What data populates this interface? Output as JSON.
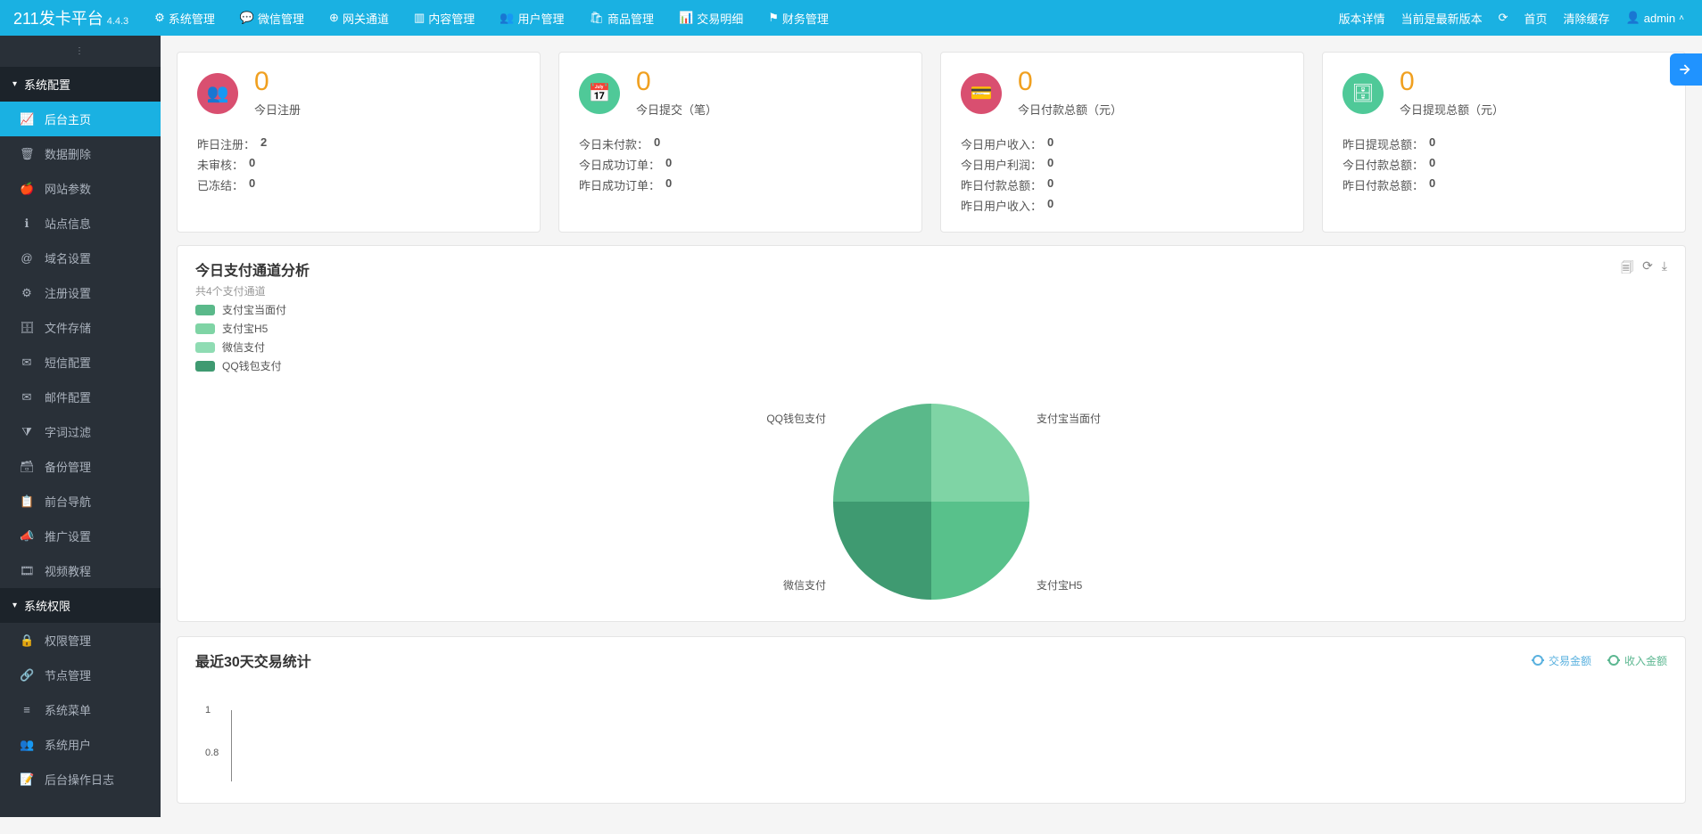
{
  "brand": {
    "name": "211发卡平台",
    "version": "4.4.3"
  },
  "top_nav": [
    {
      "label": "系统管理",
      "icon": "gear"
    },
    {
      "label": "微信管理",
      "icon": "wechat"
    },
    {
      "label": "网关通道",
      "icon": "globe"
    },
    {
      "label": "内容管理",
      "icon": "columns"
    },
    {
      "label": "用户管理",
      "icon": "users"
    },
    {
      "label": "商品管理",
      "icon": "shop"
    },
    {
      "label": "交易明细",
      "icon": "chart"
    },
    {
      "label": "财务管理",
      "icon": "flag"
    }
  ],
  "top_right": {
    "version_detail": "版本详情",
    "latest": "当前是最新版本",
    "refresh": "⟲",
    "home": "首页",
    "clear_cache": "清除缓存",
    "user": "admin"
  },
  "sidebar": {
    "groups": [
      {
        "title": "系统配置",
        "items": [
          {
            "label": "后台主页",
            "active": true
          },
          {
            "label": "数据删除"
          },
          {
            "label": "网站参数"
          },
          {
            "label": "站点信息"
          },
          {
            "label": "域名设置"
          },
          {
            "label": "注册设置"
          },
          {
            "label": "文件存储"
          },
          {
            "label": "短信配置"
          },
          {
            "label": "邮件配置"
          },
          {
            "label": "字词过滤"
          },
          {
            "label": "备份管理"
          },
          {
            "label": "前台导航"
          },
          {
            "label": "推广设置"
          },
          {
            "label": "视频教程"
          }
        ]
      },
      {
        "title": "系统权限",
        "items": [
          {
            "label": "权限管理"
          },
          {
            "label": "节点管理"
          },
          {
            "label": "系统菜单"
          },
          {
            "label": "系统用户"
          },
          {
            "label": "后台操作日志"
          }
        ]
      }
    ]
  },
  "stats": [
    {
      "color": "pink",
      "icon": "users",
      "value": "0",
      "label": "今日注册",
      "rows": [
        {
          "k": "昨日注册：",
          "v": "2"
        },
        {
          "k": "未审核：",
          "v": "0"
        },
        {
          "k": "已冻结：",
          "v": "0"
        }
      ]
    },
    {
      "color": "green",
      "icon": "calendar",
      "value": "0",
      "label": "今日提交（笔）",
      "rows": [
        {
          "k": "今日未付款：",
          "v": "0"
        },
        {
          "k": "今日成功订单：",
          "v": "0"
        },
        {
          "k": "昨日成功订单：",
          "v": "0"
        }
      ]
    },
    {
      "color": "pink",
      "icon": "card",
      "value": "0",
      "label": "今日付款总额（元）",
      "rows": [
        {
          "k": "今日用户收入：",
          "v": "0"
        },
        {
          "k": "今日用户利润：",
          "v": "0"
        },
        {
          "k": "昨日付款总额：",
          "v": "0"
        },
        {
          "k": "昨日用户收入：",
          "v": "0"
        }
      ]
    },
    {
      "color": "green",
      "icon": "db",
      "value": "0",
      "label": "今日提现总额（元）",
      "rows": [
        {
          "k": "昨日提现总额：",
          "v": "0"
        },
        {
          "k": "今日付款总额：",
          "v": "0"
        },
        {
          "k": "昨日付款总额：",
          "v": "0"
        }
      ]
    }
  ],
  "pie_panel": {
    "title": "今日支付通道分析",
    "subtitle": "共4个支付通道",
    "legend": [
      {
        "label": "支付宝当面付",
        "color": "#5ab98a"
      },
      {
        "label": "支付宝H5",
        "color": "#7fd4a5"
      },
      {
        "label": "微信支付",
        "color": "#8fdcb3"
      },
      {
        "label": "QQ钱包支付",
        "color": "#3f9a71"
      }
    ],
    "labels": {
      "tr": "支付宝当面付",
      "br": "支付宝H5",
      "bl": "微信支付",
      "tl": "QQ钱包支付"
    }
  },
  "line_panel": {
    "title": "最近30天交易统计",
    "legend": [
      {
        "label": "交易金额",
        "cls": "c1"
      },
      {
        "label": "收入金额",
        "cls": "c2"
      }
    ],
    "yticks": [
      "1",
      "0.8"
    ]
  },
  "chart_data": [
    {
      "type": "pie",
      "title": "今日支付通道分析",
      "series": [
        {
          "name": "支付宝当面付",
          "value": 25
        },
        {
          "name": "支付宝H5",
          "value": 25
        },
        {
          "name": "微信支付",
          "value": 25
        },
        {
          "name": "QQ钱包支付",
          "value": 25
        }
      ]
    },
    {
      "type": "line",
      "title": "最近30天交易统计",
      "ylim": [
        0,
        1
      ],
      "series": [
        {
          "name": "交易金额",
          "values": []
        },
        {
          "name": "收入金额",
          "values": []
        }
      ]
    }
  ]
}
